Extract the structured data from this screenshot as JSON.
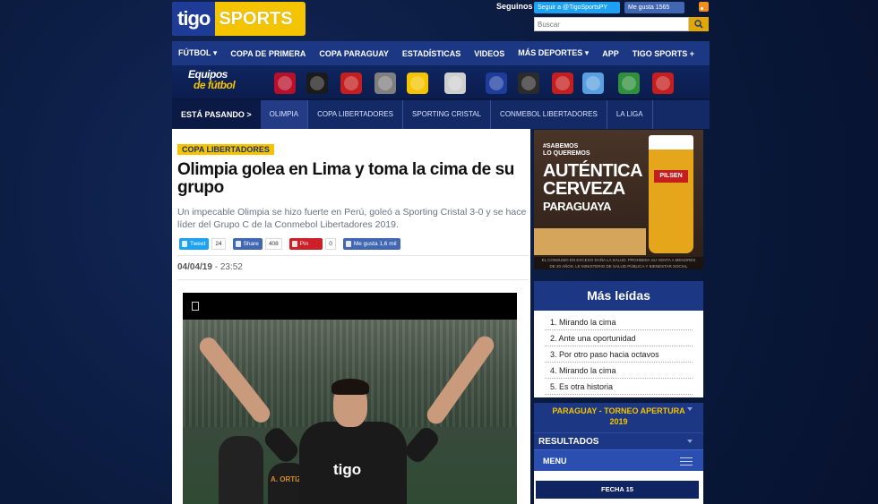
{
  "header": {
    "logo_tigo": "tigo",
    "logo_sports": "SPORTS",
    "seguinos": "Seguinos",
    "twitter_follow": "Seguir a @TigoSportsPY",
    "fb_like": "Me gusta 1565",
    "search_placeholder": "Buscar"
  },
  "nav": {
    "items": [
      "FÚTBOL ▾",
      "COPA DE PRIMERA",
      "COPA PARAGUAY",
      "ESTADÍSTICAS",
      "VIDEOS",
      "MÁS DEPORTES ▾",
      "APP",
      "TIGO SPORTS +"
    ]
  },
  "equipos": {
    "line1": "Equipos",
    "line2": "de fútbol",
    "team_colors": [
      "#b8102a",
      "#1a1a1a",
      "#c41e1e",
      "#7f7f7f",
      "#f5c400",
      "#cfcfcf",
      "#1d3c9c",
      "#2b2b2b",
      "#c41e1e",
      "#5aa0e0",
      "#2f8f3a",
      "#c41e1e"
    ]
  },
  "ticker": {
    "label": "ESTÁ PASANDO >",
    "items": [
      "OLIMPIA",
      "COPA LIBERTADORES",
      "SPORTING CRISTAL",
      "CONMEBOL LIBERTADORES",
      "LA LIGA"
    ]
  },
  "article": {
    "category": "COPA LIBERTADORES",
    "title": "Olimpia golea en Lima y toma la cima de su grupo",
    "lead": "Un impecable Olimpia se hizo fuerte en Perú, goleó a Sporting Cristal 3-0 y se hace líder del Grupo C de la Conmebol Libertadores 2019.",
    "share": {
      "tweet": "Tweet",
      "tweet_count": "24",
      "share": "Share",
      "share_count": "408",
      "pin": "Pin",
      "pin_count": "0",
      "fb_like": "Me gusta 1,6 mil"
    },
    "date": "04/04/19",
    "time": " - 23:52",
    "jersey_text": "tigo",
    "bg_name": "A. ORTIZ"
  },
  "ad": {
    "hashtag": "#SABEMOS\nLO QUEREMOS",
    "line1": "AUTÉNTICA",
    "line2": "CERVEZA",
    "line3": "PARAGUAYA",
    "brand": "PILSEN",
    "footer": "EL CONSUMO EN EXCESO DAÑA LA SALUD. PROHIBIDA SU VENTA A MENORES DE 20 AÑOS. LE MINISTERIO DE SALUD PÚBLICA Y BIENESTAR SOCIAL"
  },
  "mas_leidas": {
    "title": "Más leídas",
    "items": [
      "1. Mirando la cima",
      "2. Ante una oportunidad",
      "3. Por otro paso hacia octavos",
      "4. Mirando la cima",
      "5. Es otra historia"
    ]
  },
  "widget": {
    "title_line1": "PARAGUAY - TORNEO APERTURA",
    "title_line2": "2019",
    "resultados": "RESULTADOS",
    "menu": "MENU",
    "fecha": "FECHA 15"
  },
  "colors": {
    "primary_blue": "#1c3784",
    "accent_yellow": "#f5c400",
    "twitter": "#1da1f2",
    "facebook": "#4267b2",
    "pinterest": "#cb2027"
  }
}
